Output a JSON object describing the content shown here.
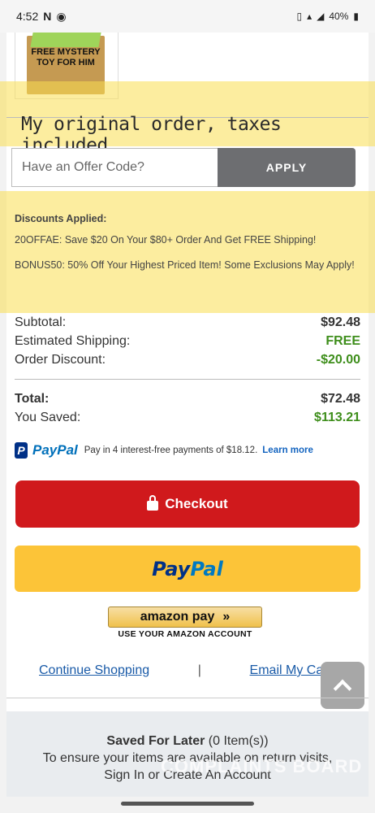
{
  "status": {
    "time": "4:52",
    "left_icons": [
      "netflix-n",
      "incognito-icon"
    ],
    "battery": "40%"
  },
  "product": {
    "image_text": "FREE MYSTERY TOY FOR HIM"
  },
  "annotation": {
    "note": "My original order, taxes included."
  },
  "offer": {
    "placeholder": "Have an Offer Code?",
    "apply_label": "APPLY"
  },
  "discounts": {
    "title": "Discounts Applied:",
    "items": [
      "20OFFAE: Save $20 On Your $80+ Order And Get FREE Shipping!",
      "BONUS50: 50% Off Your Highest Priced Item! Some Exclusions May Apply!"
    ]
  },
  "summary": {
    "subtotal_label": "Subtotal:",
    "subtotal_value": "$92.48",
    "shipping_label": "Estimated Shipping:",
    "shipping_value": "FREE",
    "discount_label": "Order Discount:",
    "discount_value": "-$20.00",
    "total_label": "Total:",
    "total_value": "$72.48",
    "saved_label": "You Saved:",
    "saved_value": "$113.21"
  },
  "paypal_credit": {
    "brand": "PayPal",
    "text": "Pay in 4 interest-free payments of $18.12.",
    "link": "Learn more"
  },
  "checkout": {
    "label": "Checkout"
  },
  "paypal_button": {
    "part1": "Pay",
    "part2": "Pal"
  },
  "amazon": {
    "label": "amazon pay",
    "caption": "USE YOUR AMAZON ACCOUNT"
  },
  "links": {
    "continue": "Continue Shopping",
    "separator": "|",
    "email": "Email My Cart"
  },
  "saved_for_later": {
    "title": "Saved For Later",
    "count": "(0 Item(s))",
    "line1": "To ensure your items are available on return visits,",
    "line2": "Sign In or Create An Account"
  },
  "watermark": "COMPLAINTS BOARD",
  "colors": {
    "checkout": "#d0191c",
    "paypal_yellow": "#fcc438",
    "discount_green": "#3e8e1b",
    "link_blue": "#1a5ba8",
    "highlight": "#fade50"
  }
}
